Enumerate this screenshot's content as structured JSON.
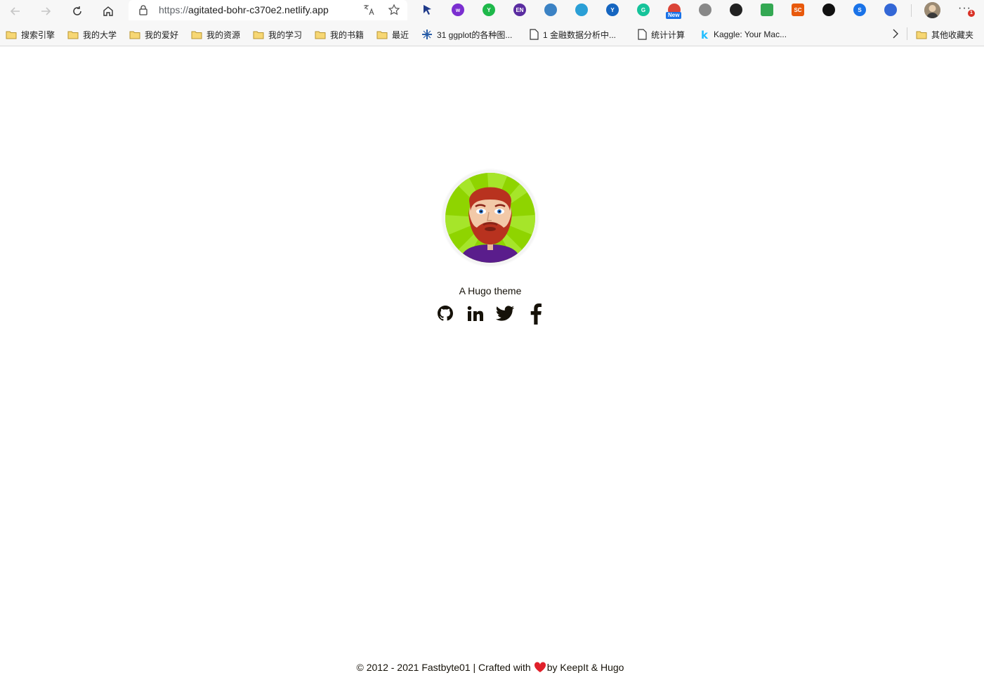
{
  "browser": {
    "url_scheme": "https://",
    "url_host": "agitated-bohr-c370e2.netlify.app",
    "extensions": [
      {
        "name": "cursor-extension-icon",
        "color": "#1f3a8a"
      },
      {
        "name": "w-extension-icon",
        "color": "#7b2fd0",
        "label": "w"
      },
      {
        "name": "y-extension-icon",
        "color": "#1eb84a",
        "label": "Y"
      },
      {
        "name": "en-extension-icon",
        "color": "#5a2ca0",
        "label": "EN"
      },
      {
        "name": "glasses-extension-icon",
        "color": "#3b82c4"
      },
      {
        "name": "bird-extension-icon",
        "color": "#2a9fd6"
      },
      {
        "name": "y-blue-extension-icon",
        "color": "#1565c0",
        "label": "Y"
      },
      {
        "name": "grammarly-icon",
        "color": "#15c39a",
        "label": "G"
      },
      {
        "name": "chrome-new-extension-icon",
        "color": "#db4437"
      },
      {
        "name": "shield-extension-icon",
        "color": "#888888"
      },
      {
        "name": "bookmark-extension-icon",
        "color": "#222222"
      },
      {
        "name": "sheet-extension-icon",
        "color": "#34a853"
      },
      {
        "name": "sc-extension-icon",
        "color": "#e8590c",
        "label": "SC"
      },
      {
        "name": "tampermonkey-icon",
        "color": "#111111"
      },
      {
        "name": "s-extension-icon",
        "color": "#1a73e8",
        "label": "S"
      },
      {
        "name": "graduation-extension-icon",
        "color": "#3367d6"
      }
    ],
    "new_badge": "New",
    "menu_badge": "1"
  },
  "bookmarks": [
    {
      "label": "搜索引擎",
      "type": "folder"
    },
    {
      "label": "我的大学",
      "type": "folder"
    },
    {
      "label": "我的爱好",
      "type": "folder"
    },
    {
      "label": "我的资源",
      "type": "folder"
    },
    {
      "label": "我的学习",
      "type": "folder"
    },
    {
      "label": "我的书籍",
      "type": "folder"
    },
    {
      "label": "最近",
      "type": "folder"
    },
    {
      "label": "31 ggplot的各种图...",
      "type": "site"
    },
    {
      "label": "1 金融数据分析中...",
      "type": "page"
    },
    {
      "label": "统计计算",
      "type": "page"
    },
    {
      "label": "Kaggle: Your Mac...",
      "type": "kaggle"
    }
  ],
  "other_bookmarks": "其他收藏夹",
  "page": {
    "subtitle": "A Hugo theme",
    "social": [
      "github",
      "linkedin",
      "twitter",
      "facebook"
    ],
    "footer_prefix": "© 2012 - 2021 Fastbyte01 | Crafted with",
    "footer_suffix": "by KeepIt & Hugo",
    "avatar_bg": "#8fd400",
    "beard_color": "#b8321f",
    "shirt_color": "#5a1d8c"
  }
}
